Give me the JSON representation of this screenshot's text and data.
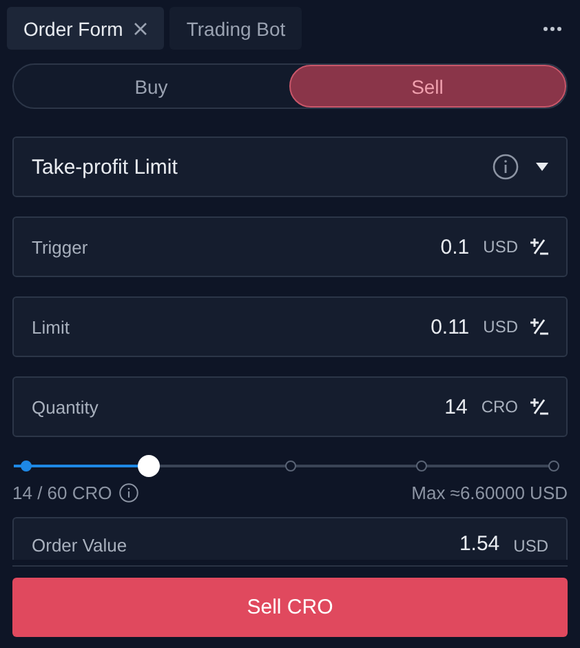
{
  "tabs": [
    {
      "label": "Order Form",
      "selected": true,
      "closable": true
    },
    {
      "label": "Trading Bot",
      "selected": false,
      "closable": false
    }
  ],
  "side_toggle": [
    {
      "label": "Buy",
      "selected": false
    },
    {
      "label": "Sell",
      "selected": true
    }
  ],
  "order_type": {
    "value": "Take-profit Limit"
  },
  "fields": [
    {
      "label": "Trigger",
      "value": "0.1",
      "unit": "USD"
    },
    {
      "label": "Limit",
      "value": "0.11",
      "unit": "USD"
    },
    {
      "label": "Quantity",
      "value": "14",
      "unit": "CRO"
    }
  ],
  "slider": {
    "level": 0.2333,
    "amount": "14 / 60 CRO",
    "max": "Max ≈6.60000 USD"
  },
  "order_value": {
    "label": "Order Value",
    "value": "1.54",
    "unit": "USD"
  },
  "submit": {
    "label": "Sell CRO"
  }
}
